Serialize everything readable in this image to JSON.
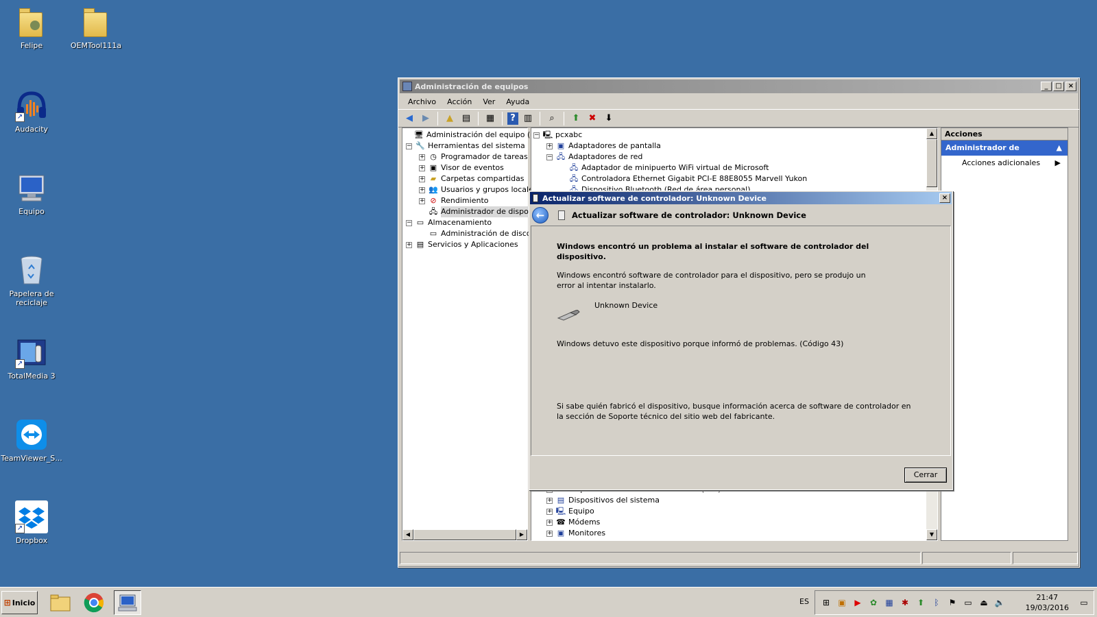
{
  "desktop": {
    "icons": [
      {
        "label": "Felipe"
      },
      {
        "label": "OEMTool111a"
      },
      {
        "label": "Audacity"
      },
      {
        "label": "Equipo"
      },
      {
        "label": "Papelera de reciclaje"
      },
      {
        "label": "TotalMedia 3"
      },
      {
        "label": "TeamViewer_S..."
      },
      {
        "label": "Dropbox"
      }
    ]
  },
  "window": {
    "title": "Administración de equipos",
    "menu": [
      "Archivo",
      "Acción",
      "Ver",
      "Ayuda"
    ],
    "left_tree": [
      "Administración del equipo (local)",
      "Herramientas del sistema",
      "Programador de tareas",
      "Visor de eventos",
      "Carpetas compartidas",
      "Usuarios y grupos locales",
      "Rendimiento",
      "Administrador de dispositi",
      "Almacenamiento",
      "Administración de discos",
      "Servicios y Aplicaciones"
    ],
    "device_tree_top": [
      "pcxabc",
      "Adaptadores de pantalla",
      "Adaptadores de red",
      "Adaptador de minipuerto WiFi virtual de Microsoft",
      "Controladora Ethernet Gigabit PCI-E 88E8055 Marvell Yukon",
      "Dispositivo Bluetooth (Red de área personal)"
    ],
    "device_tree_bottom": [
      "Dispositivos de interfaz de usuario (HID)",
      "Dispositivos del sistema",
      "Equipo",
      "Módems",
      "Monitores"
    ],
    "actions": {
      "header": "Acciones",
      "selected": "Administrador de dispositi...",
      "more": "Acciones adicionales"
    }
  },
  "dialog": {
    "title": "Actualizar software de controlador: Unknown Device",
    "heading": "Actualizar software de controlador: Unknown Device",
    "error_title": "Windows encontró un problema al instalar el software de controlador del dispositivo.",
    "para1": "Windows encontró software de controlador para el dispositivo, pero se produjo un error al intentar instalarlo.",
    "device_name": "Unknown Device",
    "para2": "Windows detuvo este dispositivo porque informó de problemas. (Código 43)",
    "para3": "Si sabe quién fabricó el dispositivo, busque información acerca de software de controlador en la sección de Soporte técnico del sitio web del fabricante.",
    "close_button": "Cerrar"
  },
  "taskbar": {
    "start_label": "Inicio",
    "language": "ES",
    "time": "21:47",
    "date": "19/03/2016"
  }
}
